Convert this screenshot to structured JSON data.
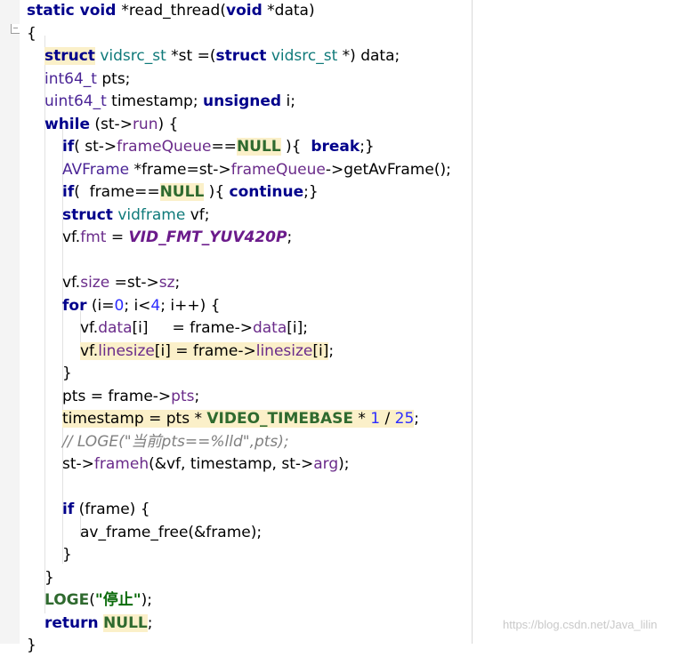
{
  "code": {
    "lines": [
      {
        "tokens": [
          {
            "t": "static void ",
            "c": "kw"
          },
          {
            "t": "*read_thread("
          },
          {
            "t": "void",
            "c": "kw"
          },
          {
            "t": " *data)"
          }
        ]
      },
      {
        "tokens": [
          {
            "t": "{"
          }
        ]
      },
      {
        "tokens": [
          {
            "t": "struct",
            "c": "kw hl"
          },
          {
            "t": " "
          },
          {
            "t": "vidsrc_st",
            "c": "ty"
          },
          {
            "t": " *st =("
          },
          {
            "t": "struct",
            "c": "kw"
          },
          {
            "t": " "
          },
          {
            "t": "vidsrc_st",
            "c": "ty"
          },
          {
            "t": " *) data;"
          }
        ]
      },
      {
        "tokens": [
          {
            "t": "int64_t",
            "c": "ty2"
          },
          {
            "t": " pts;"
          }
        ]
      },
      {
        "tokens": [
          {
            "t": "uint64_t",
            "c": "ty2"
          },
          {
            "t": " timestamp; "
          },
          {
            "t": "unsigned",
            "c": "kw"
          },
          {
            "t": " i;"
          }
        ]
      },
      {
        "tokens": [
          {
            "t": "while",
            "c": "kw"
          },
          {
            "t": " (st->"
          },
          {
            "t": "run",
            "c": "mem"
          },
          {
            "t": ") {"
          }
        ]
      },
      {
        "tokens": [
          {
            "t": "if",
            "c": "kw"
          },
          {
            "t": "( st->"
          },
          {
            "t": "frameQueue",
            "c": "mem"
          },
          {
            "t": "=="
          },
          {
            "t": "NULL",
            "c": "macro hl"
          },
          {
            "t": " ){  "
          },
          {
            "t": "break",
            "c": "kw"
          },
          {
            "t": ";}"
          }
        ]
      },
      {
        "tokens": [
          {
            "t": "AVFrame",
            "c": "ty2"
          },
          {
            "t": " *frame=st->"
          },
          {
            "t": "frameQueue",
            "c": "mem"
          },
          {
            "t": "->getAvFrame();"
          }
        ]
      },
      {
        "tokens": [
          {
            "t": "if",
            "c": "kw"
          },
          {
            "t": "(  frame=="
          },
          {
            "t": "NULL",
            "c": "macro hl"
          },
          {
            "t": " ){ "
          },
          {
            "t": "continue",
            "c": "kw"
          },
          {
            "t": ";}"
          }
        ]
      },
      {
        "tokens": [
          {
            "t": "struct",
            "c": "kw"
          },
          {
            "t": " "
          },
          {
            "t": "vidframe",
            "c": "ty"
          },
          {
            "t": " vf;"
          }
        ]
      },
      {
        "tokens": [
          {
            "t": "vf."
          },
          {
            "t": "fmt",
            "c": "mem"
          },
          {
            "t": " = "
          },
          {
            "t": "VID_FMT_YUV420P",
            "c": "enum"
          },
          {
            "t": ";"
          }
        ]
      },
      {
        "tokens": [
          {
            "t": ""
          }
        ]
      },
      {
        "tokens": [
          {
            "t": "vf."
          },
          {
            "t": "size",
            "c": "mem"
          },
          {
            "t": " =st->"
          },
          {
            "t": "sz",
            "c": "mem"
          },
          {
            "t": ";"
          }
        ]
      },
      {
        "tokens": [
          {
            "t": "for",
            "c": "kw"
          },
          {
            "t": " (i="
          },
          {
            "t": "0",
            "c": "num"
          },
          {
            "t": "; i<"
          },
          {
            "t": "4",
            "c": "num"
          },
          {
            "t": "; i++) {"
          }
        ]
      },
      {
        "tokens": [
          {
            "t": "vf."
          },
          {
            "t": "data",
            "c": "mem"
          },
          {
            "t": "[i]     = frame->"
          },
          {
            "t": "data",
            "c": "mem"
          },
          {
            "t": "[i];"
          }
        ]
      },
      {
        "tokens": [
          {
            "t": "vf.",
            "c": "hl"
          },
          {
            "t": "linesize",
            "c": "mem hl"
          },
          {
            "t": "[i] = frame->",
            "c": "hl"
          },
          {
            "t": "linesize",
            "c": "mem hl"
          },
          {
            "t": "[i]",
            "c": "hl"
          },
          {
            "t": ";"
          }
        ]
      },
      {
        "tokens": [
          {
            "t": "}"
          }
        ]
      },
      {
        "tokens": [
          {
            "t": "pts = frame->"
          },
          {
            "t": "pts",
            "c": "mem"
          },
          {
            "t": ";"
          }
        ]
      },
      {
        "tokens": [
          {
            "t": "timestamp = pts * ",
            "c": "hl"
          },
          {
            "t": "VIDEO_TIMEBASE",
            "c": "macro hl"
          },
          {
            "t": " * ",
            "c": "hl"
          },
          {
            "t": "1",
            "c": "num hl"
          },
          {
            "t": " / ",
            "c": "hl"
          },
          {
            "t": "25",
            "c": "num hl"
          },
          {
            "t": ";"
          }
        ]
      },
      {
        "tokens": [
          {
            "t": "// LOGE(\"当前pts==%lld\",pts);",
            "c": "cmt"
          }
        ]
      },
      {
        "tokens": [
          {
            "t": "st->"
          },
          {
            "t": "frameh",
            "c": "mem"
          },
          {
            "t": "(&vf, timestamp, st->"
          },
          {
            "t": "arg",
            "c": "mem"
          },
          {
            "t": ");"
          }
        ]
      },
      {
        "tokens": [
          {
            "t": ""
          }
        ]
      },
      {
        "tokens": [
          {
            "t": "if",
            "c": "kw"
          },
          {
            "t": " (frame) {"
          }
        ]
      },
      {
        "tokens": [
          {
            "t": "av_frame_free(&frame);"
          }
        ]
      },
      {
        "tokens": [
          {
            "t": "}"
          }
        ]
      },
      {
        "tokens": [
          {
            "t": "}"
          }
        ]
      },
      {
        "tokens": [
          {
            "t": "LOGE",
            "c": "macro"
          },
          {
            "t": "("
          },
          {
            "t": "\"停止\"",
            "c": "str"
          },
          {
            "t": ");"
          }
        ]
      },
      {
        "tokens": [
          {
            "t": "return",
            "c": "kw"
          },
          {
            "t": " "
          },
          {
            "t": "NULL",
            "c": "macro hl"
          },
          {
            "t": ";"
          }
        ]
      },
      {
        "tokens": [
          {
            "t": "}"
          }
        ]
      }
    ]
  },
  "watermark": "https://blog.csdn.net/Java_lilin"
}
